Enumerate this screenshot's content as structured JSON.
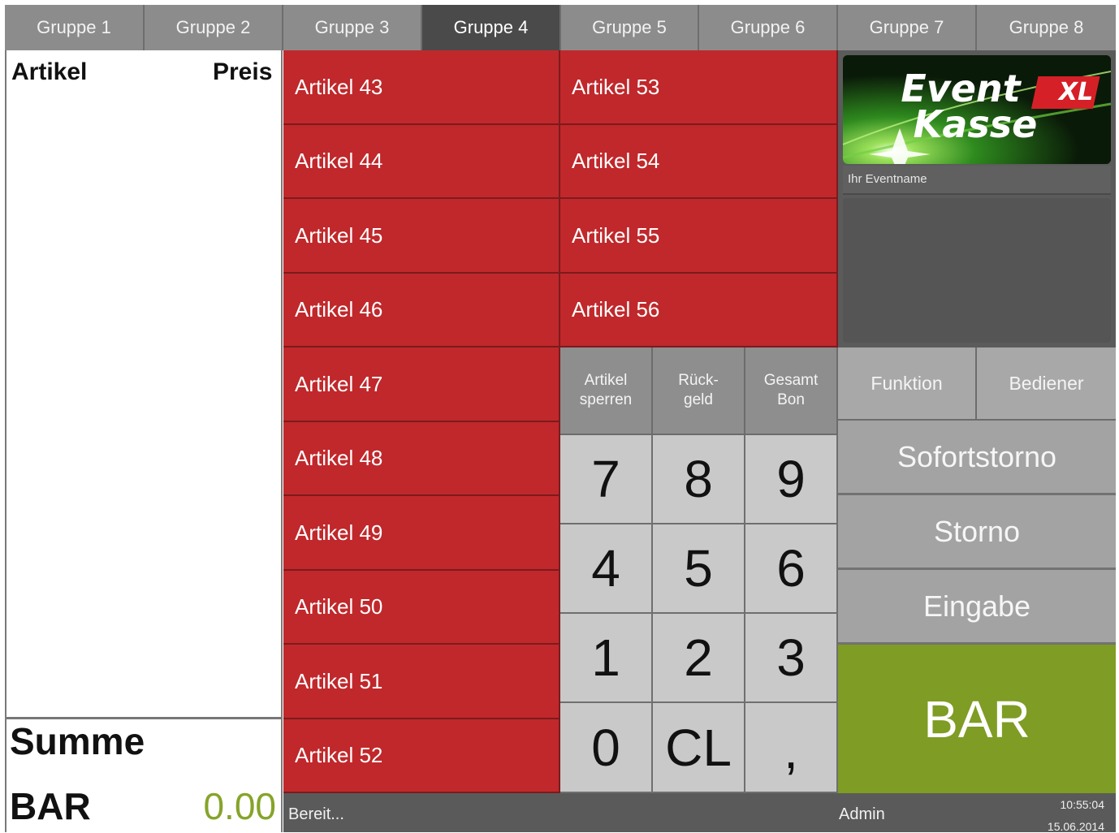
{
  "tabs": [
    {
      "label": "Gruppe 1",
      "active": false
    },
    {
      "label": "Gruppe 2",
      "active": false
    },
    {
      "label": "Gruppe 3",
      "active": false
    },
    {
      "label": "Gruppe 4",
      "active": true
    },
    {
      "label": "Gruppe 5",
      "active": false
    },
    {
      "label": "Gruppe 6",
      "active": false
    },
    {
      "label": "Gruppe 7",
      "active": false
    },
    {
      "label": "Gruppe 8",
      "active": false
    }
  ],
  "receipt": {
    "col_article": "Artikel",
    "col_price": "Preis",
    "summe_label": "Summe",
    "payment_label": "BAR",
    "total": "0.00"
  },
  "articles_left": [
    "Artikel 43",
    "Artikel 44",
    "Artikel 45",
    "Artikel 46",
    "Artikel 47",
    "Artikel 48",
    "Artikel 49",
    "Artikel 50",
    "Artikel 51",
    "Artikel 52"
  ],
  "articles_right": [
    "Artikel 53",
    "Artikel 54",
    "Artikel 55",
    "Artikel 56"
  ],
  "logo": {
    "line1": "Event",
    "line2": "Kasse",
    "badge": "XL",
    "event_name": "Ihr Eventname"
  },
  "function_keys": {
    "lock_article": [
      "Artikel",
      "sperren"
    ],
    "change": [
      "Rück-",
      "geld"
    ],
    "total_receipt": [
      "Gesamt",
      "Bon"
    ],
    "funktion": "Funktion",
    "bediener": "Bediener"
  },
  "numpad": [
    "7",
    "8",
    "9",
    "4",
    "5",
    "6",
    "1",
    "2",
    "3",
    "0",
    "CL",
    ","
  ],
  "actions": {
    "instant_void": "Sofortstorno",
    "void": "Storno",
    "entry": "Eingabe",
    "cash": "BAR"
  },
  "status": {
    "message": "Bereit...",
    "user": "Admin",
    "time": "10:55:04",
    "date": "15.06.2014"
  },
  "colors": {
    "article_red": "#c0282b",
    "cash_green": "#7f9c24",
    "total_green": "#86a42a",
    "tab_active": "#4a4a4a"
  }
}
